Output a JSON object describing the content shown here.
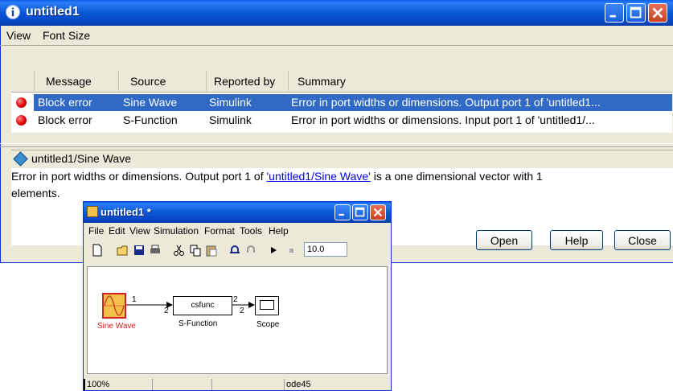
{
  "dialog": {
    "title": "untitled1",
    "menu": [
      "View",
      "Font Size"
    ],
    "columns": [
      "Message",
      "Source",
      "Reported by",
      "Summary"
    ],
    "rows": [
      {
        "message": "Block error",
        "source": "Sine Wave",
        "reported_by": "Simulink",
        "summary": "Error in port widths or dimensions.  Output port 1 of 'untitled1..."
      },
      {
        "message": "Block error",
        "source": "S-Function",
        "reported_by": "Simulink",
        "summary": "Error in port widths or dimensions.  Input port 1 of 'untitled1/..."
      }
    ],
    "path": "untitled1/Sine Wave",
    "detail_before": "Error in port widths or dimensions.  Output port 1 of ",
    "detail_link": "'untitled1/Sine Wave'",
    "detail_after": " is a one dimensional vector with 1",
    "detail_line2": "elements.",
    "buttons": {
      "open": "Open",
      "help": "Help",
      "close": "Close"
    },
    "colors": {
      "titlebar": "#0a57d6",
      "selection": "#316ac5",
      "error_dot": "#e00000"
    }
  },
  "simulink": {
    "title": "untitled1 *",
    "menu": [
      "File",
      "Edit",
      "View",
      "Simulation",
      "Format",
      "Tools",
      "Help"
    ],
    "stop_time": "10.0",
    "blocks": {
      "sine": "Sine Wave",
      "sfunc_inner": "csfunc",
      "sfunc": "S-Function",
      "scope": "Scope"
    },
    "signal_labels": {
      "a": "1",
      "b": "2",
      "c": "2",
      "d": "2"
    },
    "status": {
      "zoom": "100%",
      "solver": "ode45"
    }
  }
}
